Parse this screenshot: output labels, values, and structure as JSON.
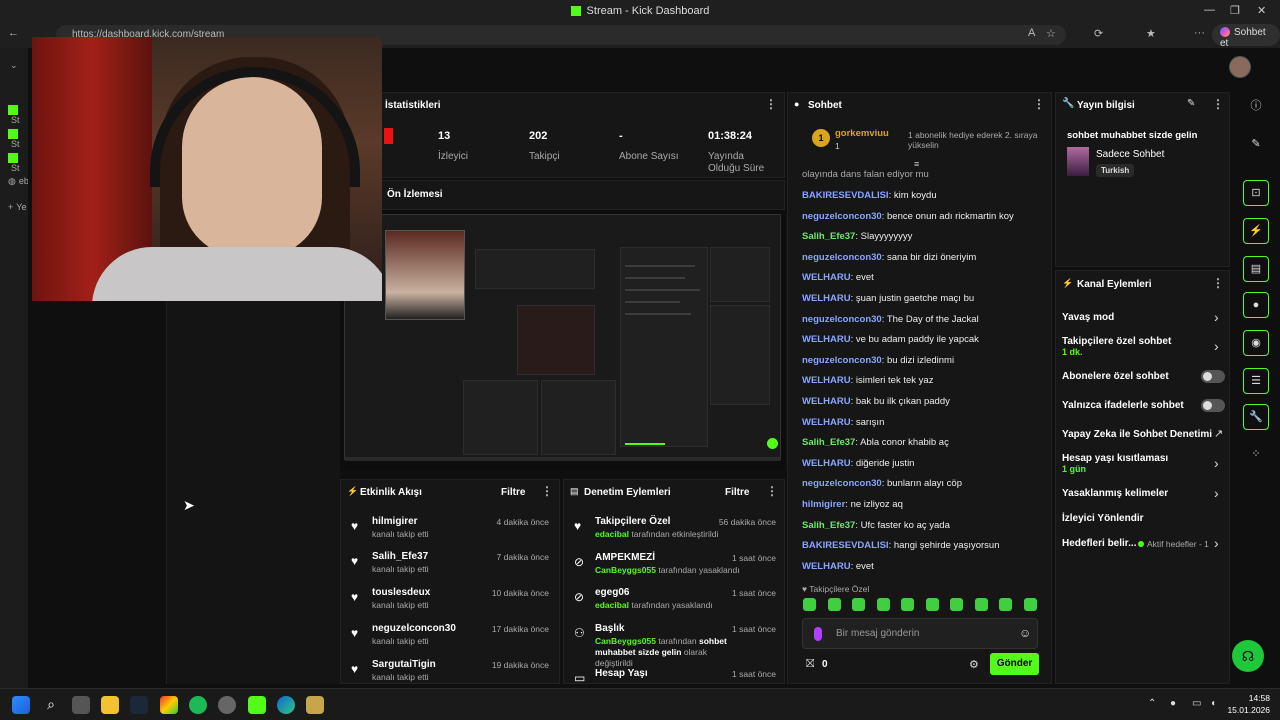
{
  "window": {
    "title": "Stream - Kick Dashboard",
    "url": "https://dashboard.kick.com/stream",
    "sohbet_btn": "Sohbet et"
  },
  "side_items": [
    "St",
    "St",
    "St",
    "eb",
    "Ye"
  ],
  "stats": {
    "title": "İstatistikleri",
    "items": [
      {
        "value": "13",
        "label": "İzleyici"
      },
      {
        "value": "202",
        "label": "Takipçi"
      },
      {
        "value": "-",
        "label": "Abone Sayısı"
      },
      {
        "value": "01:38:24",
        "label": "Yayında Olduğu Süre"
      }
    ]
  },
  "preview": {
    "title": "Ön İzlemesi"
  },
  "activity": {
    "title": "Etkinlik Akışı",
    "filter": "Filtre",
    "items": [
      {
        "name": "hilmigirer",
        "sub": "kanalı takip etti",
        "time": "4 dakika önce"
      },
      {
        "name": "Salih_Efe37",
        "sub": "kanalı takip etti",
        "time": "7 dakika önce"
      },
      {
        "name": "touslesdeux",
        "sub": "kanalı takip etti",
        "time": "10 dakika önce"
      },
      {
        "name": "neguzelconcon30",
        "sub": "kanalı takip etti",
        "time": "17 dakika önce"
      },
      {
        "name": "SargutaiTigin",
        "sub": "kanalı takip etti",
        "time": "19 dakika önce"
      }
    ]
  },
  "moderation": {
    "title": "Denetim Eylemleri",
    "filter": "Filtre",
    "items": [
      {
        "name": "Takipçilere Özel",
        "user": "edacibal",
        "sub": "tarafından etkinleştirildi",
        "time": "56 dakika önce"
      },
      {
        "name": "AMPEKMEZİ",
        "user": "CanBeyggs055",
        "sub": "tarafından yasaklandı",
        "time": "1 saat önce"
      },
      {
        "name": "egeg06",
        "user": "edacibal",
        "sub": "tarafından yasaklandı",
        "time": "1 saat önce"
      },
      {
        "name": "Başlık",
        "user": "CanBeyggs055",
        "sub": "tarafından",
        "sub2": "sohbet muhabbet sizde gelin",
        "sub3": "olarak değiştirildi",
        "time": "1 saat önce"
      },
      {
        "name": "Hesap Yaşı",
        "time": "1 saat önce"
      }
    ]
  },
  "chat": {
    "title": "Sohbet",
    "pinned_user": "gorkemviuu",
    "pinned_count": "1",
    "pinned_msg": "1 abonelik hediye ederek 2. sıraya yükselin",
    "partial_top": "olayında dans falan ediyor mu",
    "messages": [
      {
        "user": "BAKIRESEVDALISI",
        "text": "kim koydu",
        "color": "blue"
      },
      {
        "user": "neguzelconcon30",
        "text": "bence onun adı rickmartin koy",
        "color": "blue"
      },
      {
        "user": "Salih_Efe37",
        "text": "Slayyyyyyyy",
        "color": "green"
      },
      {
        "user": "neguzelconcon30",
        "text": "sana bir dizi öneriyim",
        "color": "blue"
      },
      {
        "user": "WELHARU",
        "text": "evet",
        "color": "blue"
      },
      {
        "user": "WELHARU",
        "text": "şuan justin gaetche maçı bu",
        "color": "blue"
      },
      {
        "user": "neguzelconcon30",
        "text": "The Day of the Jackal",
        "color": "blue"
      },
      {
        "user": "WELHARU",
        "text": "ve bu adam paddy ile yapcak",
        "color": "blue"
      },
      {
        "user": "neguzelconcon30",
        "text": "bu dizi izledinmi",
        "color": "blue"
      },
      {
        "user": "WELHARU",
        "text": "isimleri tek tek yaz",
        "color": "blue"
      },
      {
        "user": "WELHARU",
        "text": "bak bu ilk çıkan paddy",
        "color": "blue"
      },
      {
        "user": "WELHARU",
        "text": "sarışın",
        "color": "blue"
      },
      {
        "user": "Salih_Efe37",
        "text": "Abla conor khabib aç",
        "color": "green"
      },
      {
        "user": "WELHARU",
        "text": "diğeride justin",
        "color": "blue"
      },
      {
        "user": "neguzelconcon30",
        "text": "bunların alayı cöp",
        "color": "blue"
      },
      {
        "user": "hilmigirer",
        "text": "ne izliyoz aq",
        "color": "blue"
      },
      {
        "user": "Salih_Efe37",
        "text": "Ufc faster ko aç yada",
        "color": "green"
      },
      {
        "user": "BAKIRESEVDALISI",
        "text": "hangi şehirde yaşıyorsun",
        "color": "blue"
      },
      {
        "user": "WELHARU",
        "text": "evet",
        "color": "blue"
      }
    ],
    "followers_only": "Takipçilere Özel",
    "input_placeholder": "Bir mesaj gönderin",
    "gift_count": "0",
    "send": "Gönder"
  },
  "info": {
    "title": "Yayın bilgisi",
    "stream_title": "sohbet muhabbet sizde gelin",
    "category": "Sadece Sohbet",
    "tag": "Turkish"
  },
  "actions": {
    "title": "Kanal Eylemleri",
    "slow_mode": "Yavaş mod",
    "followers_chat": "Takipçilere özel sohbet",
    "followers_sub": "1 dk.",
    "subs_chat": "Abonelere özel sohbet",
    "emote_chat": "Yalnızca ifadelerle sohbet",
    "ai_mod": "Yapay Zeka ile Sohbet Denetimi",
    "account_age": "Hesap yaşı kısıtlaması",
    "account_age_sub": "1 gün",
    "banned_words": "Yasaklanmış kelimeler",
    "redirect": "İzleyici Yönlendir",
    "goals": "Hedefleri belir...",
    "goals_sub": "Aktif hedefler - 1"
  },
  "taskbar": {
    "time": "14:58",
    "date": "15.01.2026"
  },
  "colors": {
    "accent": "#53fc18",
    "username_blue": "#88a6ff",
    "username_green": "#6ee86e"
  }
}
